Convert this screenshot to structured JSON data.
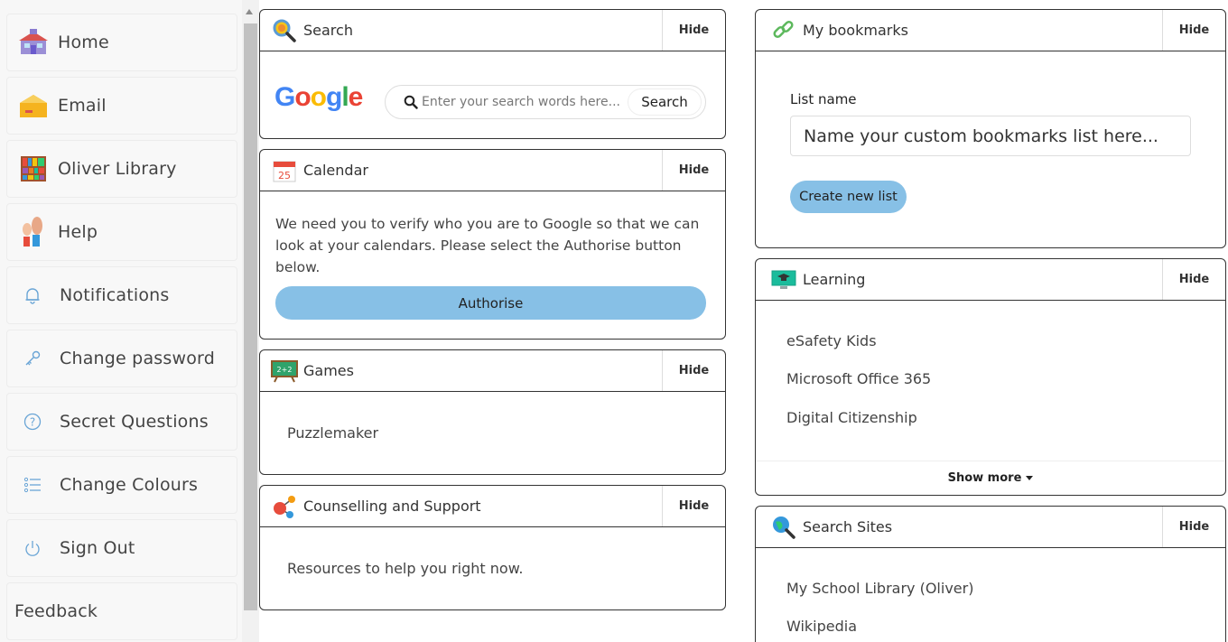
{
  "sidebar": {
    "items": [
      {
        "label": "Home",
        "icon": "school-icon"
      },
      {
        "label": "Email",
        "icon": "mailbox-icon"
      },
      {
        "label": "Oliver Library",
        "icon": "bookshelf-icon"
      },
      {
        "label": "Help",
        "icon": "raised-hands-icon"
      },
      {
        "label": "Notifications",
        "icon": "bell-icon"
      },
      {
        "label": "Change password",
        "icon": "key-icon"
      },
      {
        "label": "Secret Questions",
        "icon": "question-circle-icon"
      },
      {
        "label": "Change Colours",
        "icon": "list-icon"
      },
      {
        "label": "Sign Out",
        "icon": "power-icon"
      },
      {
        "label": "Feedback"
      }
    ]
  },
  "hide_label": "Hide",
  "search_panel": {
    "title": "Search",
    "logo_text": [
      "G",
      "o",
      "o",
      "g",
      "l",
      "e"
    ],
    "logo_colors": [
      "#4285F4",
      "#EA4335",
      "#FBBC05",
      "#4285F4",
      "#34A853",
      "#EA4335"
    ],
    "placeholder": "Enter your search words here...",
    "button": "Search"
  },
  "calendar_panel": {
    "title": "Calendar",
    "icon_day": "25",
    "message": "We need you to verify who you are to Google so that we can look at your calendars. Please select the Authorise button below.",
    "button": "Authorise"
  },
  "games_panel": {
    "title": "Games",
    "board_text": "2+2",
    "items": [
      "Puzzlemaker"
    ]
  },
  "counselling_panel": {
    "title": "Counselling and Support",
    "items": [
      "Resources to help you right now."
    ]
  },
  "bookmarks_panel": {
    "title": "My bookmarks",
    "list_label": "List name",
    "placeholder": "Name your custom bookmarks list here...",
    "button": "Create new list"
  },
  "learning_panel": {
    "title": "Learning",
    "items": [
      "eSafety Kids",
      "Microsoft Office 365",
      "Digital Citizenship"
    ],
    "show_more": "Show more"
  },
  "search_sites_panel": {
    "title": "Search Sites",
    "items": [
      "My School Library (Oliver)",
      "Wikipedia"
    ]
  },
  "colors": {
    "accent_button": "#87c0e6",
    "panel_border": "#333333",
    "sidebar_bg": "#f7f7f7"
  }
}
